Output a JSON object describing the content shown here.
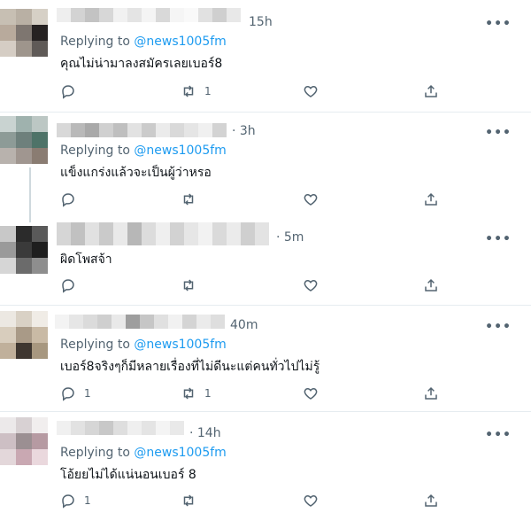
{
  "tweets": [
    {
      "time": "15h",
      "replying_label": "Replying to",
      "handle": "@news1005fm",
      "text": "คุณไม่น่ามาลงสมัครเลยเบอร์8",
      "reply_count": "",
      "retweet_count": "1",
      "more_label": "•••"
    },
    {
      "time": "· 3h",
      "replying_label": "Replying to",
      "handle": "@news1005fm",
      "text": "แข็งแกร่งแล้วจะเป็นผู้ว่าหรอ",
      "reply_count": "",
      "retweet_count": "",
      "more_label": "•••"
    },
    {
      "time": "· 5m",
      "text": "ผิดโพสจ้า",
      "reply_count": "",
      "retweet_count": "",
      "more_label": "•••"
    },
    {
      "time": "40m",
      "replying_label": "Replying to",
      "handle": "@news1005fm",
      "text": "เบอร์8จริงๆก็มีหลายเรื่องที่ไม่ดีนะแต่คนทั่วไปไม่รู้",
      "reply_count": "1",
      "retweet_count": "1",
      "more_label": "•••"
    },
    {
      "time": "· 14h",
      "replying_label": "Replying to",
      "handle": "@news1005fm",
      "text": "โอ้ยยไม่ได้แน่นอนเบอร์ 8",
      "reply_count": "1",
      "retweet_count": "",
      "more_label": "•••"
    }
  ],
  "colors": {
    "handle": "#1d9bf0",
    "muted": "#536471",
    "text": "#0f1419",
    "divider": "#e6ecf0"
  },
  "icons": [
    "reply-icon",
    "retweet-icon",
    "like-icon",
    "share-icon",
    "more-icon"
  ]
}
